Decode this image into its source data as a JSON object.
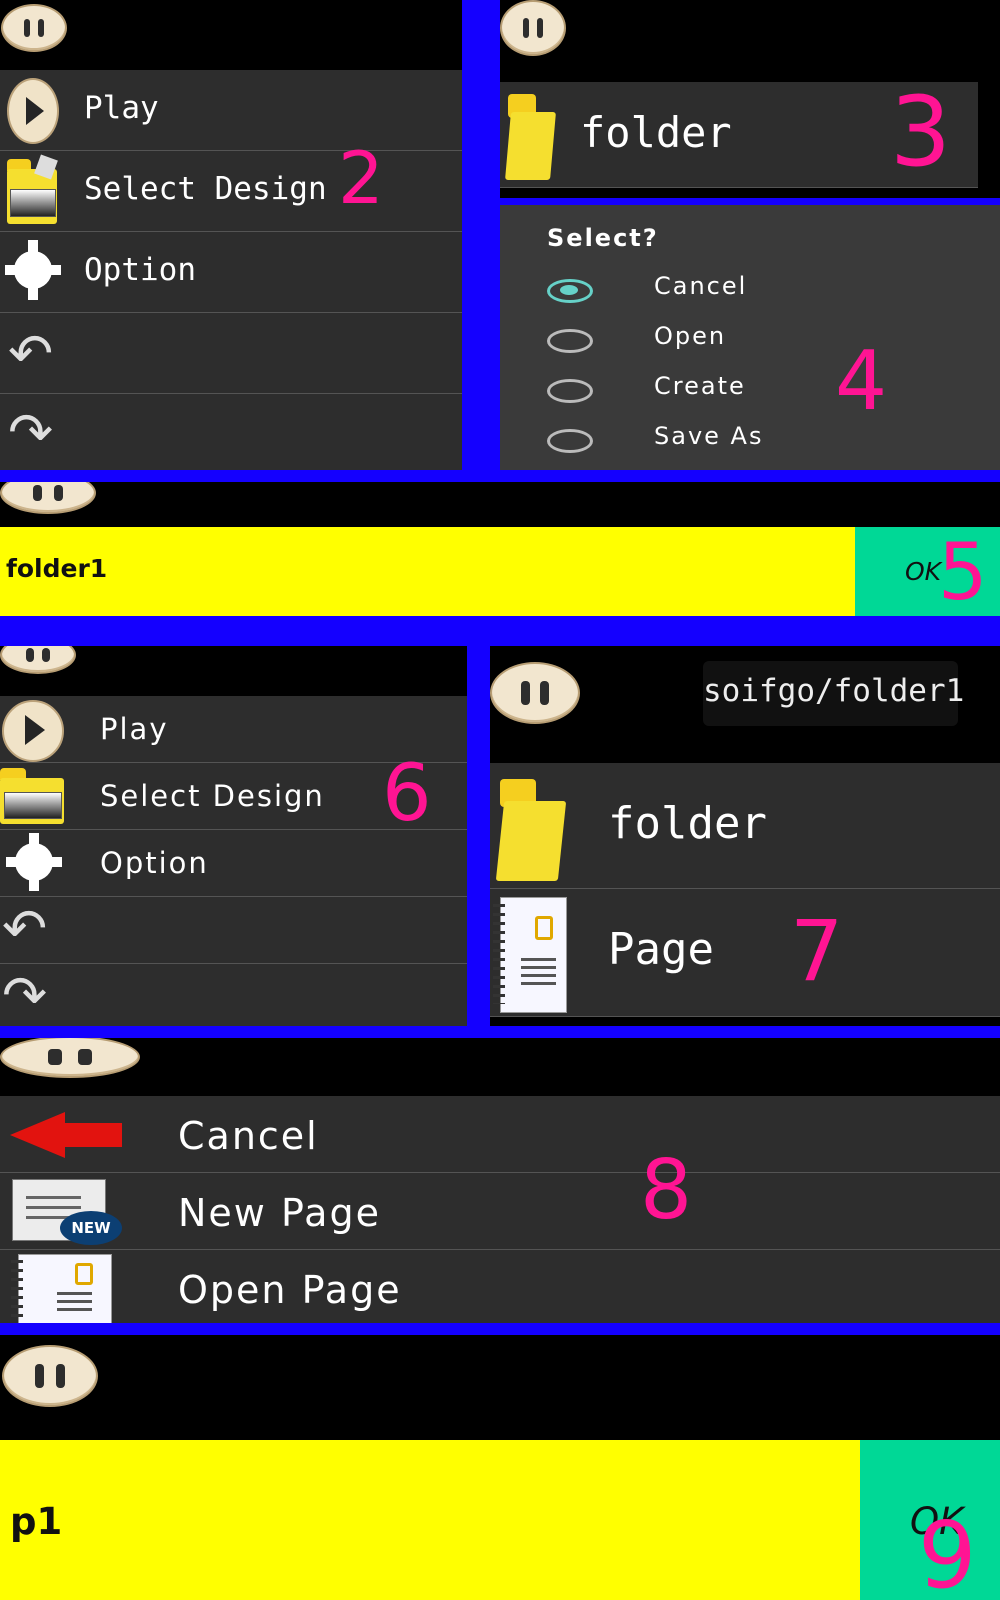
{
  "screens": {
    "s2": {
      "marker": "2",
      "menu": [
        {
          "label": "Play",
          "icon": "play-icon"
        },
        {
          "label": "Select Design",
          "icon": "folder-icon"
        },
        {
          "label": "Option",
          "icon": "gear-icon"
        },
        {
          "label": "",
          "icon": "undo-icon"
        },
        {
          "label": "",
          "icon": "redo-icon"
        }
      ]
    },
    "s3": {
      "marker": "3",
      "item_label": "folder"
    },
    "s4": {
      "marker": "4",
      "title": "Select?",
      "options": [
        {
          "label": "Cancel",
          "selected": true
        },
        {
          "label": "Open",
          "selected": false
        },
        {
          "label": "Create",
          "selected": false
        },
        {
          "label": "Save As",
          "selected": false
        }
      ]
    },
    "s5": {
      "marker": "5",
      "input_value": "folder1",
      "ok_label": "OK"
    },
    "s6": {
      "marker": "6",
      "menu": [
        {
          "label": "Play"
        },
        {
          "label": "Select Design"
        },
        {
          "label": "Option"
        },
        {
          "label": ""
        },
        {
          "label": ""
        }
      ]
    },
    "s7": {
      "marker": "7",
      "path": "soifgo/folder1",
      "items": [
        {
          "label": "folder",
          "icon": "folder-icon"
        },
        {
          "label": "Page",
          "icon": "page-icon"
        }
      ]
    },
    "s8": {
      "marker": "8",
      "items": [
        {
          "label": "Cancel",
          "icon": "back-arrow-icon"
        },
        {
          "label": "New Page",
          "icon": "new-page-icon",
          "badge": "NEW"
        },
        {
          "label": "Open Page",
          "icon": "page-icon"
        }
      ]
    },
    "s9": {
      "marker": "9",
      "input_value": "p1",
      "ok_label": "OK"
    }
  },
  "colors": {
    "divider": "#1400ff",
    "menu_bg": "#2d2d2d",
    "marker": "#ff1493",
    "input_bg": "#ffff00",
    "ok_bg": "#00d896",
    "folder": "#f5df2f",
    "radio_selected": "#66d1c8"
  }
}
